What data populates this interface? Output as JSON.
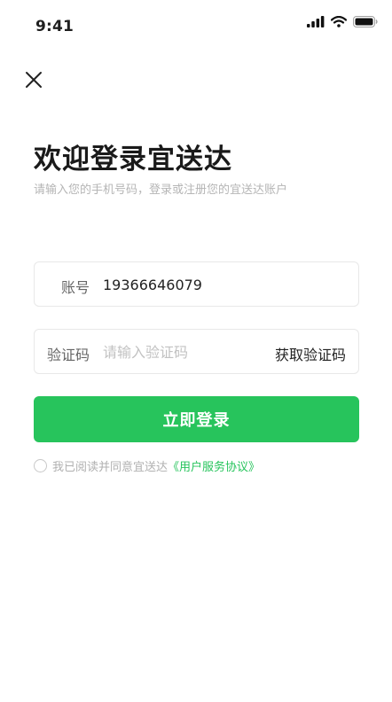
{
  "status_bar": {
    "time": "9:41",
    "icons": [
      "cellular-signal-icon",
      "wifi-icon",
      "battery-icon"
    ]
  },
  "header": {
    "close_icon": "close-icon"
  },
  "login": {
    "title": "欢迎登录宜送达",
    "subtitle": "请输入您的手机号码，登录或注册您的宜送达账户",
    "account": {
      "label": "账号",
      "value": "19366646079"
    },
    "code": {
      "label": "验证码",
      "placeholder": "请输入验证码",
      "value": "",
      "get_code_label": "获取验证码"
    },
    "submit_label": "立即登录",
    "agreement": {
      "text": "我已阅读并同意宜送达",
      "link": "《用户服务协议》",
      "checked": false
    }
  },
  "colors": {
    "accent": "#27c45c",
    "text_primary": "#1a1a1a",
    "text_muted": "#b5b5b5",
    "border": "#e8e8e8"
  }
}
